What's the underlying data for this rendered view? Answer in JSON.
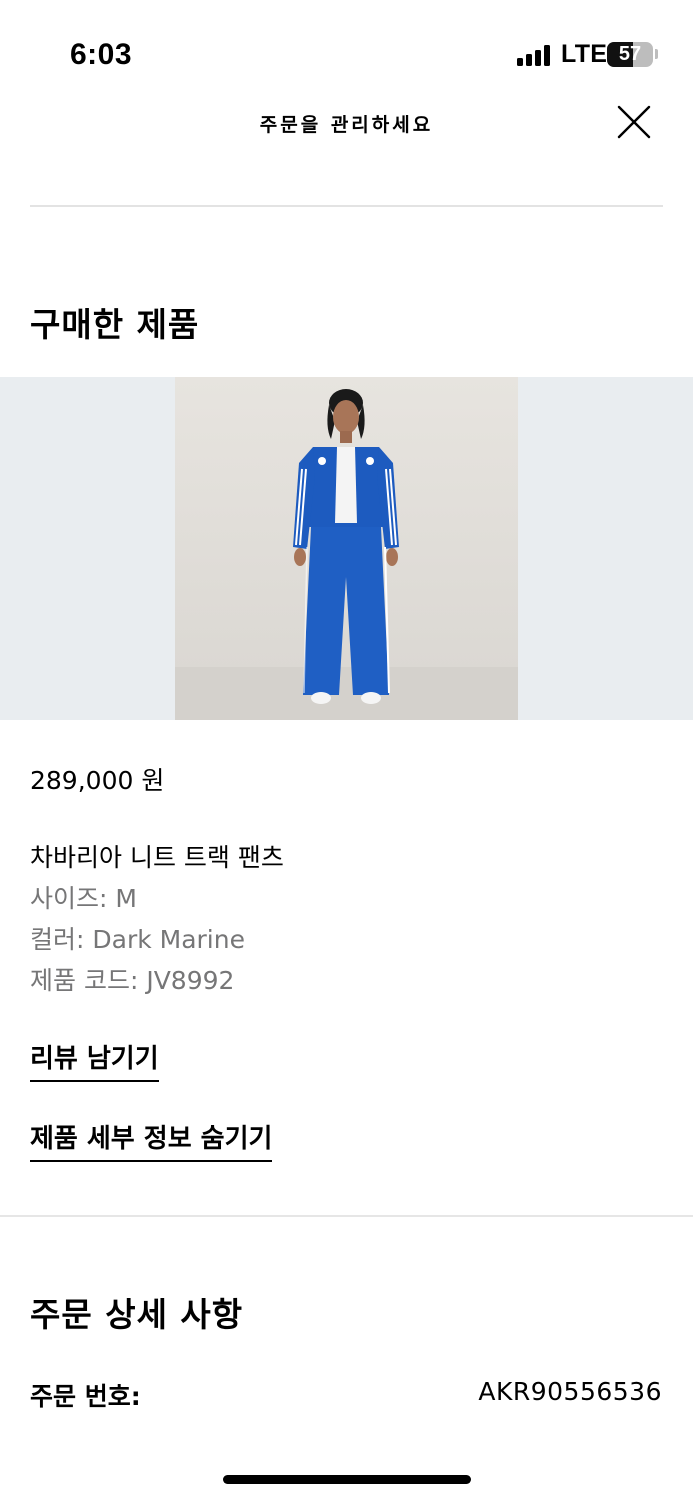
{
  "status_bar": {
    "time": "6:03",
    "network": "LTE",
    "battery": "57",
    "battery_level": 0.57
  },
  "header": {
    "title": "주문을 관리하세요",
    "close_icon": "close-icon"
  },
  "purchased": {
    "section_title": "구매한 제품",
    "product": {
      "image_icon": "product-photo",
      "price": "289,000 원",
      "name": "차바리아 니트 트랙 팬츠",
      "size": "사이즈: M",
      "color": "컬러: Dark Marine",
      "code": "제품 코드: JV8992"
    },
    "links": {
      "review": "리뷰 남기기",
      "hide_details": "제품 세부 정보 숨기기"
    }
  },
  "order_details": {
    "section_title": "주문 상세 사항",
    "order_number_label": "주문 번호:",
    "order_number_value": "AKR90556536"
  },
  "colors": {
    "accent": "#000000",
    "muted_text": "#767677",
    "product_band": "#e9edf0",
    "garment": "#1d5bbf"
  }
}
